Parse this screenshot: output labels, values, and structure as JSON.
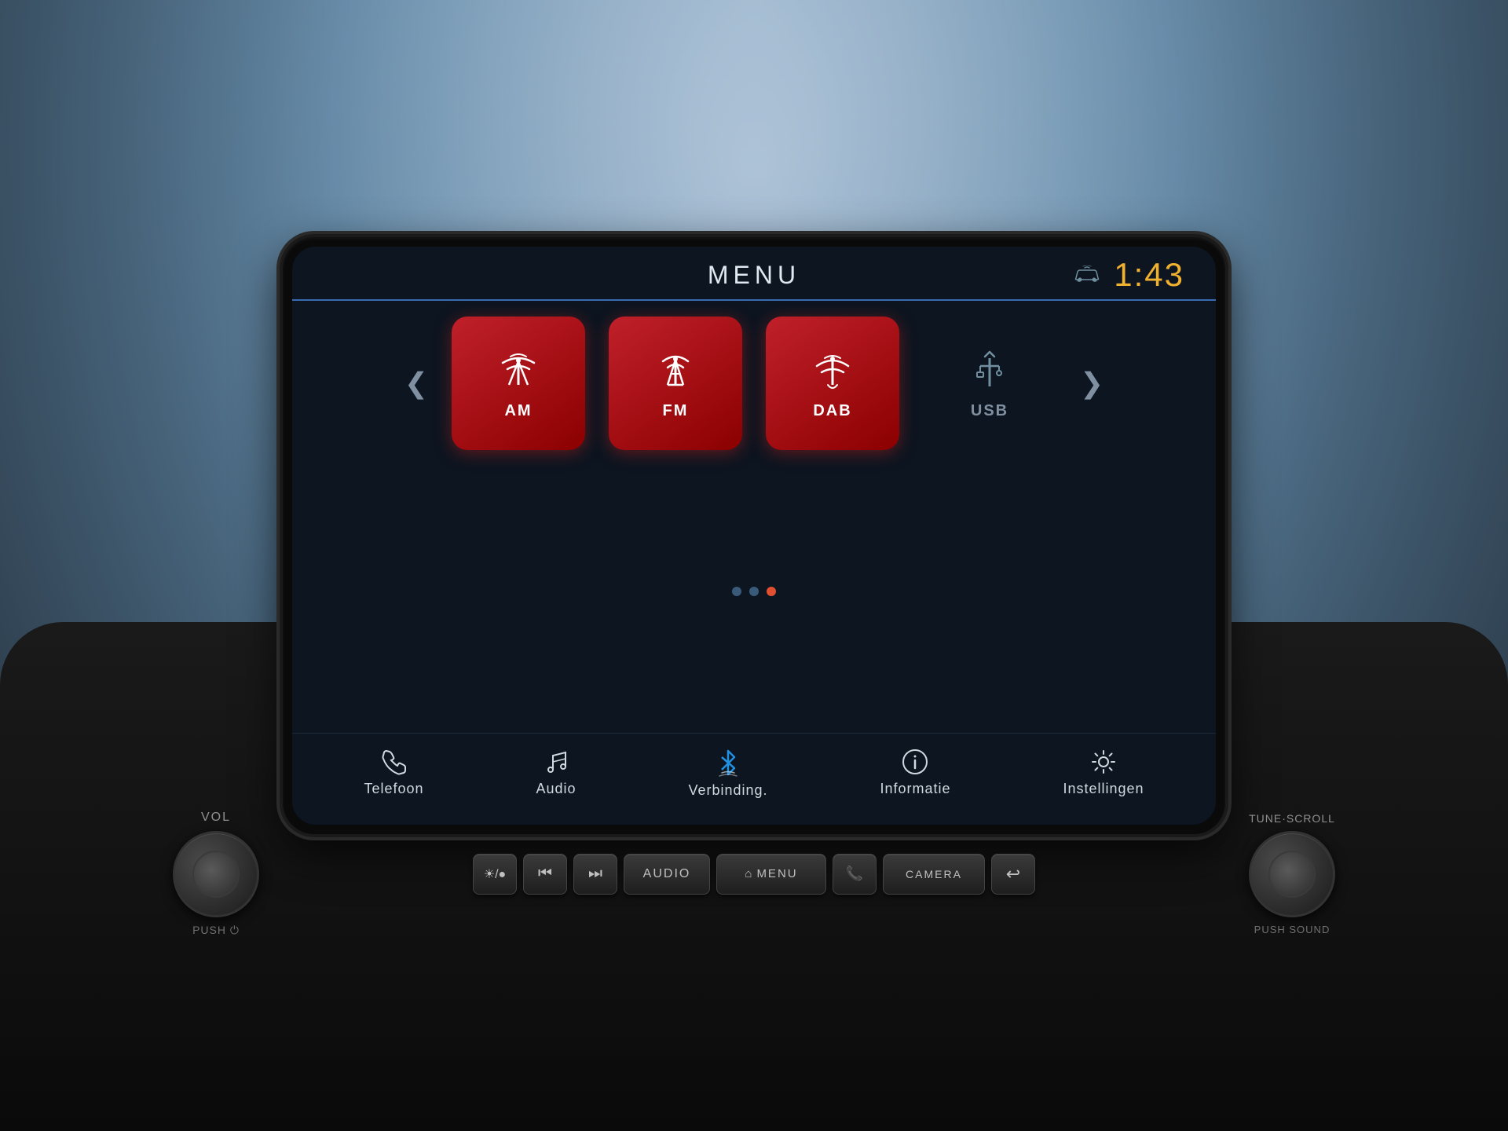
{
  "background": {
    "color": "#2a3040"
  },
  "screen": {
    "header": {
      "title": "MENU",
      "clock": "1:43",
      "car_icon": "🚗"
    },
    "tiles": [
      {
        "id": "am",
        "label": "AM",
        "active": true,
        "icon": "radio"
      },
      {
        "id": "fm",
        "label": "FM",
        "active": true,
        "icon": "radio-tower"
      },
      {
        "id": "dab",
        "label": "DAB",
        "active": true,
        "icon": "radio-dab"
      },
      {
        "id": "usb",
        "label": "USB",
        "active": false,
        "icon": "usb"
      }
    ],
    "pagination": {
      "dots": 3,
      "active_dot": 2
    },
    "bottom_nav": [
      {
        "id": "telefoon",
        "label": "Telefoon",
        "icon": "phone"
      },
      {
        "id": "audio",
        "label": "Audio",
        "icon": "music"
      },
      {
        "id": "verbinding",
        "label": "Verbinding.",
        "icon": "bluetooth"
      },
      {
        "id": "informatie",
        "label": "Informatie",
        "icon": "info"
      },
      {
        "id": "instellingen",
        "label": "Instellingen",
        "icon": "settings"
      }
    ]
  },
  "controls": {
    "vol_label": "VOL",
    "push_label": "PUSH ⏻",
    "tune_label": "TUNE·SCROLL",
    "push_sound_label": "PUSH SOUND",
    "buttons": [
      {
        "id": "brightness",
        "label": "☀/🌙",
        "type": "icon"
      },
      {
        "id": "prev",
        "label": "⏮",
        "type": "icon"
      },
      {
        "id": "next",
        "label": "⏭",
        "type": "icon"
      },
      {
        "id": "audio",
        "label": "AUDIO",
        "type": "wide"
      },
      {
        "id": "menu",
        "label": "⌂ MENU",
        "type": "home"
      },
      {
        "id": "phone",
        "label": "📞",
        "type": "icon"
      },
      {
        "id": "camera",
        "label": "CAMERA",
        "type": "medium"
      },
      {
        "id": "back",
        "label": "↩",
        "type": "back"
      }
    ]
  },
  "nav_arrows": {
    "left": "❮",
    "right": "❯"
  }
}
